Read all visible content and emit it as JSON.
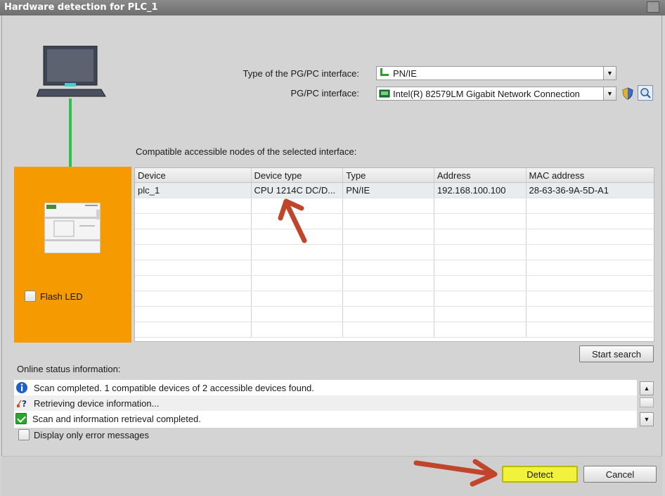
{
  "window": {
    "title": "Hardware detection for PLC_1"
  },
  "interface": {
    "type_label": "Type of the PG/PC interface:",
    "type_value": "PN/IE",
    "pgpc_label": "PG/PC interface:",
    "pgpc_value": "Intel(R) 82579LM Gigabit Network Connection"
  },
  "nodes_label": "Compatible accessible nodes of the selected interface:",
  "table": {
    "columns": [
      "Device",
      "Device type",
      "Type",
      "Address",
      "MAC address"
    ],
    "rows": [
      [
        "plc_1",
        "CPU 1214C DC/D...",
        "PN/IE",
        "192.168.100.100",
        "28-63-36-9A-5D-A1"
      ]
    ]
  },
  "flash_led_label": "Flash LED",
  "start_search_label": "Start search",
  "status": {
    "label": "Online status information:",
    "messages": [
      {
        "icon": "info-icon",
        "text": "Scan completed. 1 compatible devices of 2 accessible devices found."
      },
      {
        "icon": "retrieving-icon",
        "text": "Retrieving device information..."
      },
      {
        "icon": "check-icon",
        "text": "Scan and information retrieval completed."
      }
    ],
    "only_errors_label": "Display only error messages"
  },
  "buttons": {
    "detect": "Detect",
    "cancel": "Cancel"
  },
  "colors": {
    "accent_orange": "#f59a00",
    "cable_green": "#2fc24a",
    "detect_yellow": "#f2f23c",
    "annotation_arrow": "#c0452a"
  }
}
